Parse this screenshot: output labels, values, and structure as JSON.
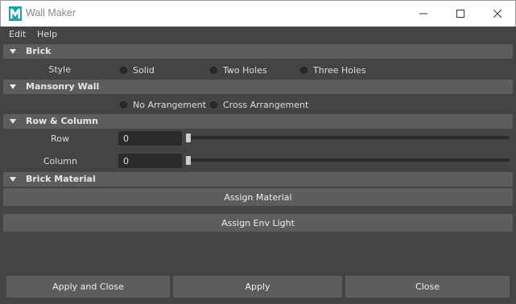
{
  "window": {
    "title": "Wall Maker",
    "app_icon": "maya-icon",
    "controls": [
      "minimize-icon",
      "maximize-icon",
      "close-icon"
    ]
  },
  "menu": {
    "items": [
      {
        "label": "Edit"
      },
      {
        "label": "Help"
      }
    ]
  },
  "brick": {
    "header": "Brick",
    "style_label": "Style",
    "options": [
      {
        "label": "Solid"
      },
      {
        "label": "Two Holes"
      },
      {
        "label": "Three Holes"
      }
    ]
  },
  "masonry": {
    "header": "Mansonry Wall",
    "options": [
      {
        "label": "No Arrangement"
      },
      {
        "label": "Cross Arrangement"
      }
    ]
  },
  "rowcol": {
    "header": "Row & Column",
    "row_label": "Row",
    "row_value": "0",
    "col_label": "Column",
    "col_value": "0"
  },
  "material": {
    "header": "Brick Material",
    "assign_material": "Assign Material",
    "assign_env_light": "Assign Env Light"
  },
  "footer": {
    "apply_close": "Apply and Close",
    "apply": "Apply",
    "close": "Close"
  },
  "colors": {
    "background": "#444444",
    "header": "#5d5d5d",
    "field": "#2b2b2b",
    "icon_teal": "#16a5a5"
  }
}
